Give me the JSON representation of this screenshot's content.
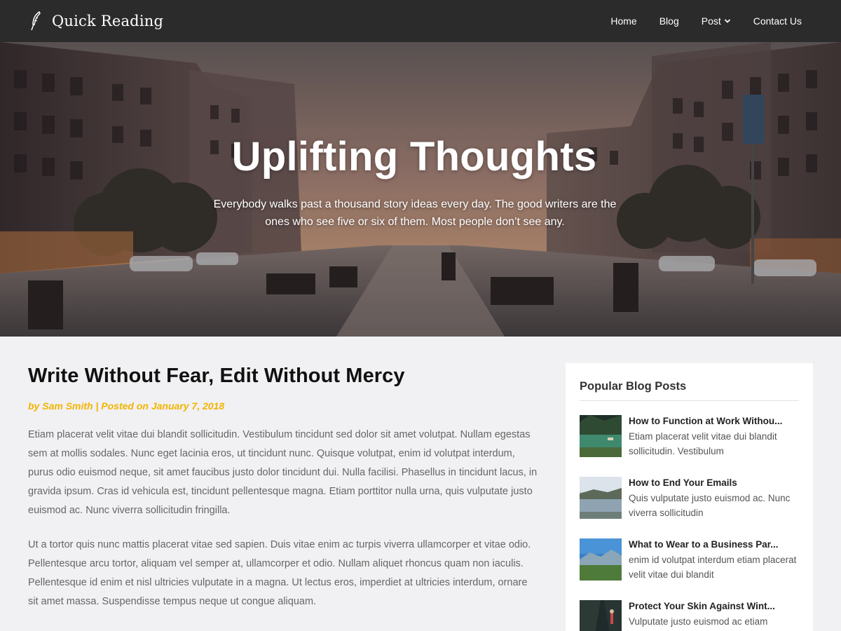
{
  "brand": {
    "title": "Quick Reading",
    "icon": "quill-feather-icon"
  },
  "nav": {
    "items": [
      {
        "label": "Home"
      },
      {
        "label": "Blog"
      },
      {
        "label": "Post",
        "has_dropdown": true
      },
      {
        "label": "Contact Us"
      }
    ]
  },
  "hero": {
    "title": "Uplifting Thoughts",
    "subtitle": "Everybody walks past a thousand story ideas every day. The good writers are the ones who see five or six of them. Most people don’t see any."
  },
  "article": {
    "title": "Write Without Fear, Edit Without Mercy",
    "byline": "by Sam Smith | Posted on January 7, 2018",
    "paragraphs": [
      "Etiam placerat velit vitae dui blandit sollicitudin. Vestibulum tincidunt sed dolor sit amet volutpat. Nullam egestas sem at mollis sodales. Nunc eget lacinia eros, ut tincidunt nunc. Quisque volutpat, enim id volutpat interdum, purus odio euismod neque, sit amet faucibus justo dolor tincidunt dui. Nulla facilisi. Phasellus in tincidunt lacus, in gravida ipsum. Cras id vehicula est, tincidunt pellentesque magna. Etiam porttitor nulla urna, quis vulputate justo euismod ac. Nunc viverra sollicitudin fringilla.",
      "Ut a tortor quis nunc mattis placerat vitae sed sapien. Duis vitae enim ac turpis viverra ullamcorper et vitae odio. Pellentesque arcu tortor, aliquam vel semper at, ullamcorper et odio. Nullam aliquet rhoncus quam non iaculis. Pellentesque id enim et nisl ultricies vulputate in a magna. Ut lectus eros, imperdiet at ultricies interdum, ornare sit amet massa. Suspendisse tempus neque ut congue aliquam."
    ]
  },
  "sidebar": {
    "title": "Popular Blog Posts",
    "posts": [
      {
        "title": "How to Function at Work Withou...",
        "excerpt": "Etiam placerat velit vitae dui blandit sollicitudin. Vestibulum"
      },
      {
        "title": "How to End Your Emails",
        "excerpt": "Quis vulputate justo euismod ac. Nunc viverra sollicitudin"
      },
      {
        "title": "What to Wear to a Business Par...",
        "excerpt": "enim id volutpat interdum etiam placerat velit vitae dui blandit"
      },
      {
        "title": "Protect Your Skin Against Wint...",
        "excerpt": "Vulputate justo euismod ac etiam"
      }
    ]
  },
  "colors": {
    "navbar": "#2b2b2b",
    "accent": "#f2b400",
    "page_bg": "#f1f1f3"
  }
}
